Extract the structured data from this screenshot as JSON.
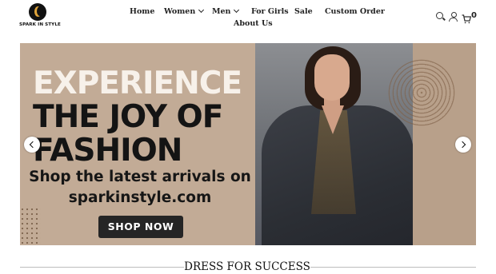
{
  "brand": {
    "name": "SPARK IN STYLE"
  },
  "nav": {
    "items": [
      {
        "label": "Home"
      },
      {
        "label": "Women"
      },
      {
        "label": "Men"
      },
      {
        "label": "For Girls"
      },
      {
        "label": "Sale"
      },
      {
        "label": "Custom Order"
      },
      {
        "label": "About Us"
      }
    ]
  },
  "header_icons": {
    "search": "search-icon",
    "account": "account-icon",
    "cart": "cart-icon",
    "cart_count": "0"
  },
  "banner": {
    "headline_line1": "EXPERIENCE",
    "headline_line2": "THE JOY OF",
    "headline_line3": "FASHION",
    "subtext_line1": "Shop the latest arrivals on",
    "subtext_line2": "sparkinstyle.com",
    "cta_label": "SHOP NOW"
  },
  "section": {
    "title": "DRESS FOR SUCCESS"
  },
  "colors": {
    "banner_bg": "#c2ab96",
    "button_bg": "#252525",
    "logo_accent": "#e0a43a"
  }
}
